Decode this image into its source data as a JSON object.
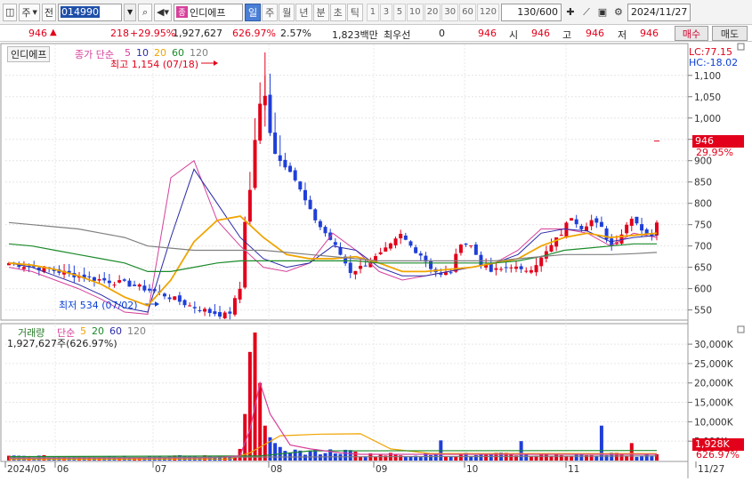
{
  "toolbar": {
    "market": "주",
    "prev_label": "전",
    "stock_code": "014990",
    "stock_name": "인디에프",
    "name_chip": "종",
    "periods": [
      {
        "label": "일",
        "active": true
      },
      {
        "label": "주",
        "active": false
      },
      {
        "label": "월",
        "active": false
      },
      {
        "label": "년",
        "active": false
      },
      {
        "label": "분",
        "active": false
      },
      {
        "label": "초",
        "active": false
      },
      {
        "label": "틱",
        "active": false
      }
    ],
    "nperiods": [
      "1",
      "3",
      "5",
      "10",
      "20",
      "30",
      "60",
      "120"
    ],
    "count": "130",
    "count_total": "/600",
    "date": "2024/11/27"
  },
  "quote": {
    "price": "946",
    "change": "218",
    "change_pct": "+29.95%",
    "volume": "1,927,627",
    "vol_ratio": "626.97%",
    "turnover": "2.57%",
    "amount": "1,823백만",
    "pref_label": "최우선",
    "pref_value": "0",
    "pref_price": "946",
    "open_label": "시",
    "open": "946",
    "high_label": "고",
    "high": "946",
    "low_label": "저",
    "low": "946",
    "buy_label": "매수",
    "sell_label": "매도"
  },
  "price_panel": {
    "name": "인디에프",
    "indicator": "종가 단순",
    "ma_labels": [
      "5",
      "10",
      "20",
      "60",
      "120"
    ],
    "max_note": "최고 1,154 (07/18)",
    "min_note": "최저 534 (07/02)",
    "lc": "LC:77.15",
    "hc": "HC:-18.02",
    "cur_price": "946",
    "cur_pct": "29.95%",
    "axis": [
      "1,100",
      "1,050",
      "1,000",
      "950",
      "900",
      "850",
      "800",
      "750",
      "700",
      "650",
      "600",
      "550"
    ]
  },
  "volume_panel": {
    "title": "거래량",
    "indicator": "단순",
    "ma_labels": [
      "5",
      "20",
      "60",
      "120"
    ],
    "value_line": "1,927,627주(626.97%)",
    "cur_vol": "1,928K",
    "cur_pct": "626.97%",
    "axis": [
      "30,000K",
      "25,000K",
      "20,000K",
      "15,000K",
      "10,000K",
      "5,000K"
    ]
  },
  "xaxis": [
    "2024/05",
    "06",
    "07",
    "08",
    "09",
    "10",
    "11",
    "11/27"
  ],
  "colors": {
    "up": "#e2001a",
    "down": "#1f3fd8",
    "ma5": "#d6409b",
    "ma10": "#2a2aa8",
    "ma20": "#f0a400",
    "ma60": "#1a8a2a",
    "ma120": "#808080"
  },
  "chart_data": {
    "type": "candlestick",
    "x_start": "2024/05",
    "x_end": "2024/11/27",
    "price_range": [
      520,
      1160
    ],
    "max_point": {
      "date": "07/18",
      "value": 1154
    },
    "min_point": {
      "date": "07/02",
      "value": 534
    },
    "last_close": 946,
    "series": [
      {
        "name": "5",
        "approx_values": [
          650,
          640,
          620,
          600,
          575,
          545,
          540,
          860,
          900,
          760,
          700,
          650,
          640,
          660,
          730,
          690,
          640,
          620,
          630,
          640,
          650,
          660,
          690,
          740,
          740,
          730,
          700,
          730,
          720
        ]
      },
      {
        "name": "10",
        "approx_values": [
          660,
          650,
          630,
          610,
          585,
          555,
          545,
          720,
          880,
          800,
          720,
          670,
          650,
          660,
          700,
          690,
          650,
          630,
          630,
          640,
          650,
          660,
          680,
          730,
          740,
          735,
          710,
          720,
          725
        ]
      },
      {
        "name": "20",
        "approx_values": [
          660,
          655,
          645,
          630,
          610,
          580,
          560,
          620,
          710,
          760,
          770,
          720,
          680,
          670,
          670,
          675,
          660,
          640,
          640,
          645,
          650,
          660,
          670,
          700,
          720,
          730,
          720,
          725,
          730
        ]
      },
      {
        "name": "60",
        "approx_values": [
          705,
          700,
          690,
          680,
          670,
          660,
          640,
          640,
          650,
          660,
          665,
          665,
          665,
          665,
          665,
          665,
          660,
          660,
          660,
          660,
          660,
          660,
          665,
          675,
          690,
          695,
          700,
          705,
          705
        ]
      },
      {
        "name": "120",
        "approx_values": [
          755,
          750,
          745,
          740,
          730,
          720,
          700,
          695,
          690,
          690,
          690,
          690,
          685,
          680,
          675,
          670,
          665,
          665,
          665,
          665,
          665,
          665,
          670,
          675,
          680,
          680,
          680,
          682,
          685
        ]
      }
    ],
    "volume_ma_names": [
      "5",
      "20",
      "60",
      "120"
    ]
  }
}
